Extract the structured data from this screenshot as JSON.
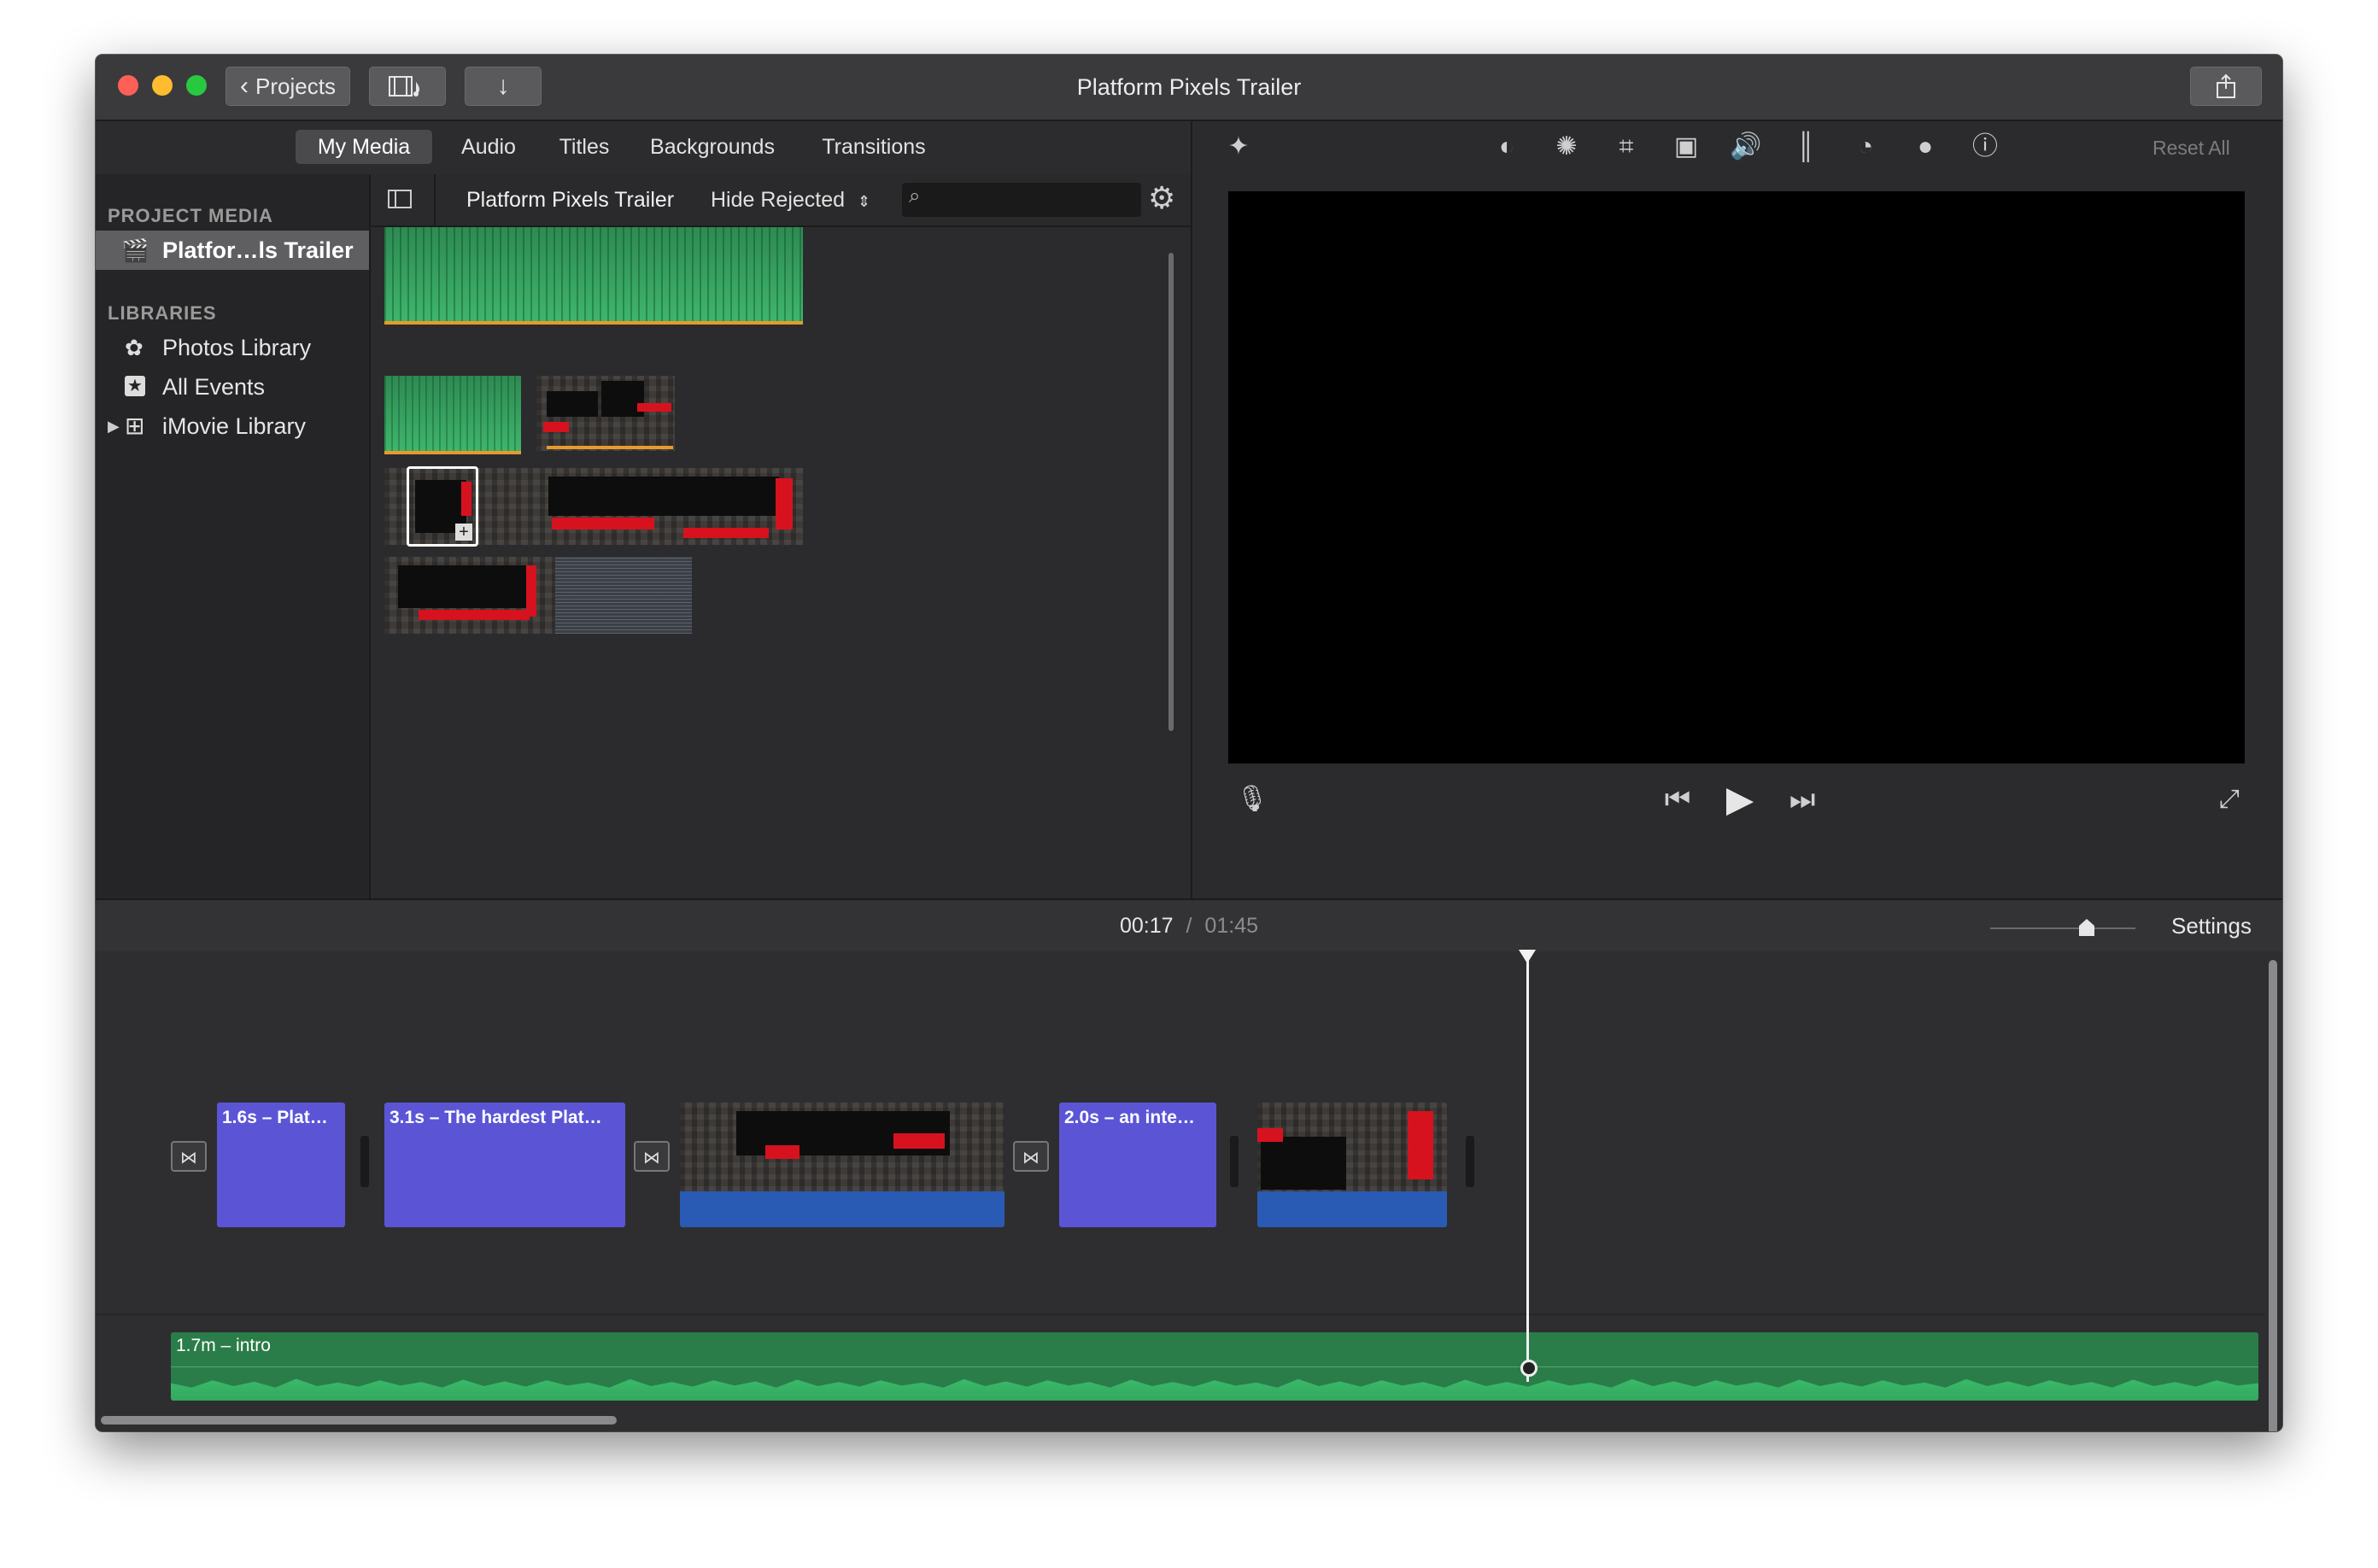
{
  "window": {
    "title": "Platform Pixels Trailer",
    "back_label": "Projects"
  },
  "nav_tabs": [
    "My Media",
    "Audio",
    "Titles",
    "Backgrounds",
    "Transitions"
  ],
  "sidebar": {
    "project_media_heading": "PROJECT MEDIA",
    "project_item": "Platfor…ls Trailer",
    "libraries_heading": "LIBRARIES",
    "libraries": [
      "Photos Library",
      "All Events",
      "iMovie Library"
    ]
  },
  "browser": {
    "title": "Platform Pixels Trailer",
    "filter": "Hide Rejected",
    "search_placeholder": ""
  },
  "viewer": {
    "reset_label": "Reset All"
  },
  "timeline": {
    "current_time": "00:17",
    "separator": "/",
    "total_time": "01:45",
    "settings_label": "Settings",
    "clips": [
      "1.6s – Plat…",
      "3.1s – The hardest Plat…",
      "2.0s – an inte…"
    ],
    "audio_clip": "1.7m – intro"
  },
  "colors": {
    "title_clip": "#5b55d6",
    "audio_track": "#2f9a58",
    "video_bar": "#2a5bb4",
    "accent_orange": "#e89a2c"
  },
  "icons": [
    "back-chevron-icon",
    "media-library-icon",
    "import-icon",
    "share-icon",
    "magic-wand-icon",
    "color-balance-icon",
    "color-correction-icon",
    "crop-icon",
    "stabilization-icon",
    "volume-icon",
    "equalizer-icon",
    "speed-icon",
    "clip-filter-icon",
    "info-icon",
    "microphone-icon",
    "skip-back-icon",
    "play-icon",
    "skip-forward-icon",
    "fullscreen-icon",
    "gear-icon",
    "search-icon",
    "sidebar-toggle-icon",
    "clapper-icon",
    "photos-icon",
    "star-icon",
    "grid-icon"
  ]
}
